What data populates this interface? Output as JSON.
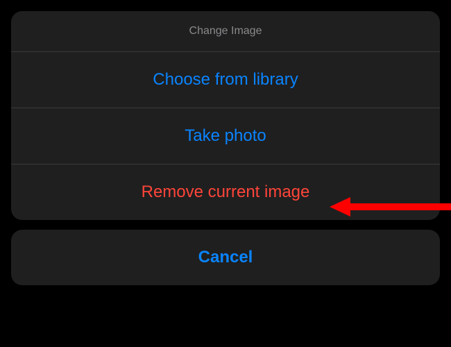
{
  "sheet": {
    "title": "Change Image",
    "options": [
      {
        "label": "Choose from library",
        "style": "blue"
      },
      {
        "label": "Take photo",
        "style": "blue"
      },
      {
        "label": "Remove current image",
        "style": "red"
      }
    ],
    "cancel_label": "Cancel"
  },
  "colors": {
    "background": "#000000",
    "sheet_bg": "#1f1f1f",
    "title_text": "#8a8a8e",
    "divider": "#3a3a3c",
    "accent_blue": "#0a84ff",
    "accent_red": "#ff453a",
    "annotation_red": "#ff0000"
  }
}
